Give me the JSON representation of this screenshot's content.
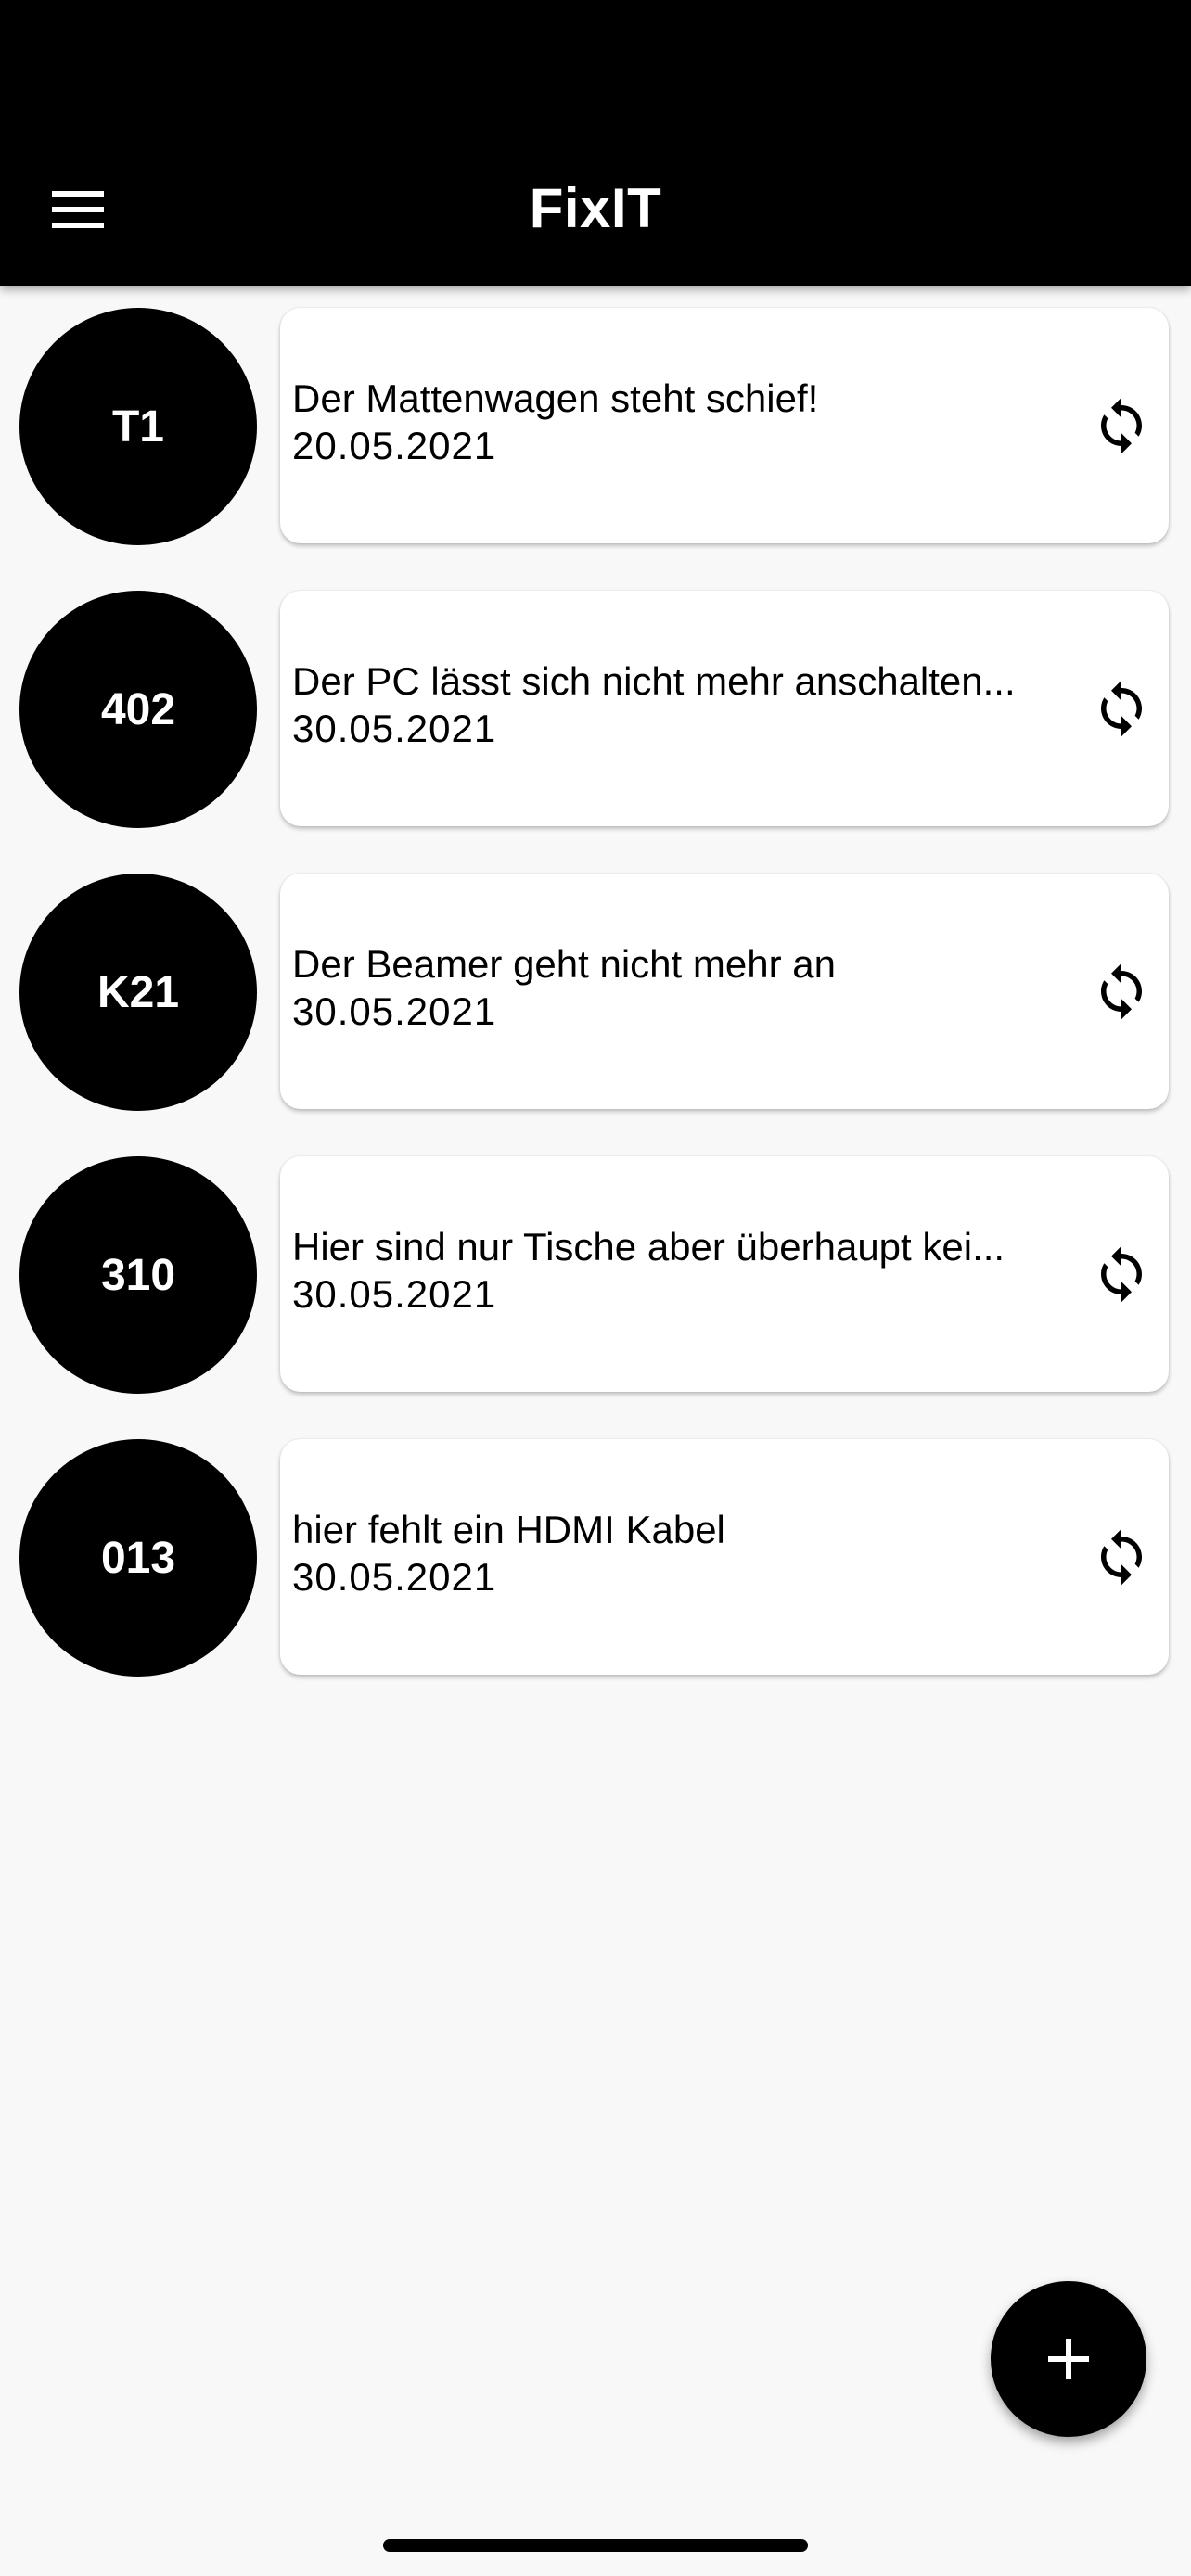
{
  "appbar": {
    "title": "FixIT",
    "menu_icon": "hamburger-menu-icon"
  },
  "tickets": [
    {
      "room": "T1",
      "title": "Der Mattenwagen steht schief!",
      "date": "20.05.2021",
      "action_icon": "sync-icon"
    },
    {
      "room": "402",
      "title": "Der PC lässt sich nicht mehr anschalten...",
      "date": "30.05.2021",
      "action_icon": "sync-icon"
    },
    {
      "room": "K21",
      "title": "Der Beamer geht nicht mehr an",
      "date": "30.05.2021",
      "action_icon": "sync-icon"
    },
    {
      "room": "310",
      "title": "Hier sind nur Tische aber überhaupt kei...",
      "date": "30.05.2021",
      "action_icon": "sync-icon"
    },
    {
      "room": "013",
      "title": "hier fehlt ein HDMI Kabel",
      "date": "30.05.2021",
      "action_icon": "sync-icon"
    }
  ],
  "fab": {
    "icon": "plus-icon"
  },
  "colors": {
    "appbar_background": "#000000",
    "page_background": "#f8f8f8",
    "avatar_background": "#000000",
    "card_background": "#ffffff"
  }
}
